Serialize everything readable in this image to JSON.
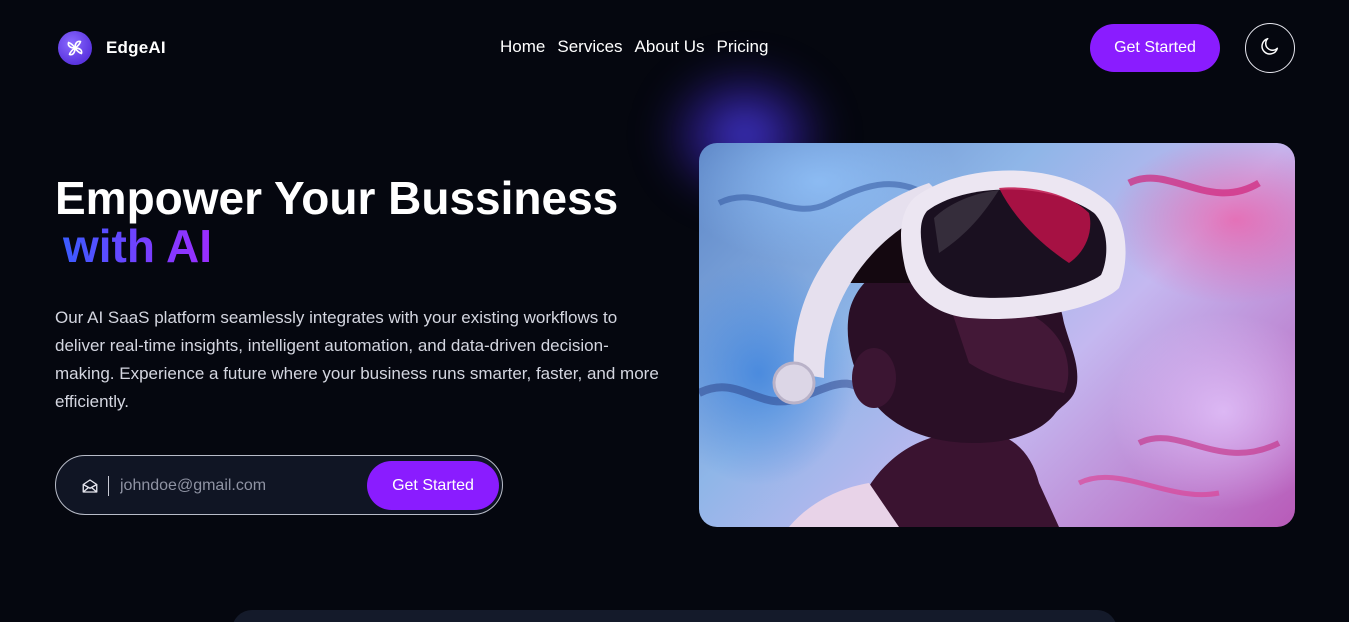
{
  "brand": {
    "name": "EdgeAI",
    "logo_icon": "pinwheel-icon"
  },
  "nav": {
    "items": [
      {
        "label": "Home"
      },
      {
        "label": "Services"
      },
      {
        "label": "About Us"
      },
      {
        "label": "Pricing"
      }
    ]
  },
  "header": {
    "cta_label": "Get Started",
    "theme_icon": "moon-icon"
  },
  "hero": {
    "title": "Empower Your Bussiness",
    "title_accent": "with AI",
    "description": "Our AI SaaS platform seamlessly integrates with your existing workflows to deliver real-time insights, intelligent automation, and data-driven decision-making. Experience a future where your business runs smarter, faster, and more efficiently.",
    "form": {
      "email_placeholder": "johndoe@gmail.com",
      "email_value": "",
      "submit_label": "Get Started",
      "icon": "envelope-icon"
    },
    "image": {
      "subject": "person-wearing-vr-headset"
    }
  },
  "colors": {
    "background": "#05070f",
    "accent_purple": "#8a1cff",
    "accent_gradient_start": "#3b5bff",
    "accent_gradient_end": "#9b2dff",
    "logo_purple": "#6a45ec"
  }
}
